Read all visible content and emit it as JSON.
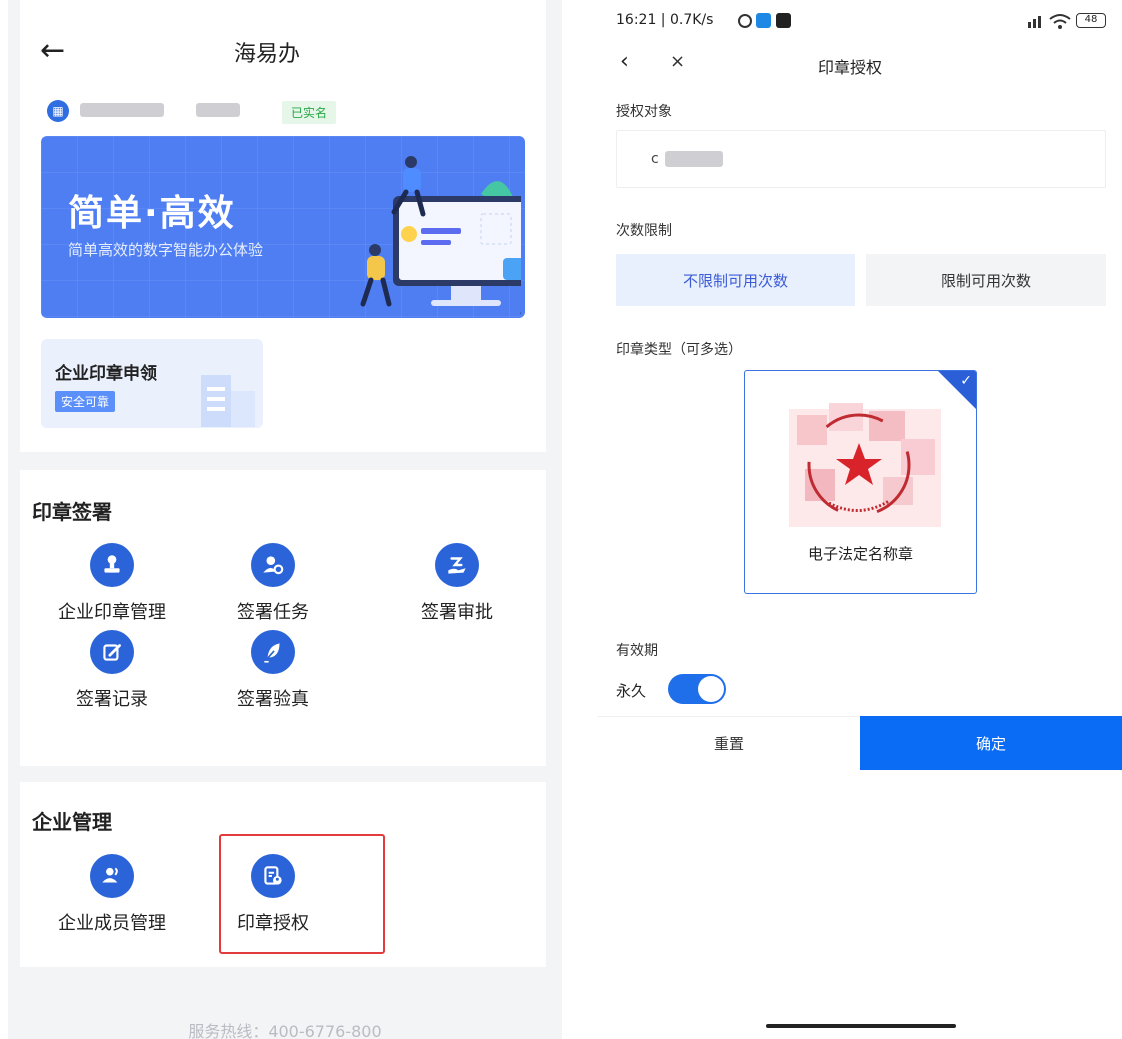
{
  "left": {
    "header": {
      "back_icon": "arrow-left-icon",
      "title": "海易办"
    },
    "company": {
      "verified_label": "已实名"
    },
    "banner": {
      "title": "简单·高效",
      "subtitle": "简单高效的数字智能办公体验"
    },
    "seal_apply_card": {
      "title": "企业印章申领",
      "tag": "安全可靠"
    },
    "seal_signing": {
      "title": "印章签署",
      "items": [
        {
          "label": "企业印章管理",
          "icon": "stamp-icon"
        },
        {
          "label": "签署任务",
          "icon": "user-gear-icon"
        },
        {
          "label": "签署审批",
          "icon": "hand-approve-icon"
        },
        {
          "label": "签署记录",
          "icon": "edit-record-icon"
        },
        {
          "label": "签署验真",
          "icon": "feather-verify-icon"
        }
      ]
    },
    "enterprise_mgmt": {
      "title": "企业管理",
      "items": [
        {
          "label": "企业成员管理",
          "icon": "members-icon"
        },
        {
          "label": "印章授权",
          "icon": "document-user-icon"
        }
      ]
    },
    "hotline": "服务热线：400-6776-800"
  },
  "right": {
    "status_bar": {
      "text": "16:21 | 0.7K/s",
      "battery": "48"
    },
    "nav": {
      "back_icon": "chevron-left-icon",
      "close_icon": "close-icon",
      "title": "印章授权"
    },
    "auth_target": {
      "label": "授权对象",
      "value": "c"
    },
    "count_limit": {
      "label": "次数限制",
      "options": [
        "不限制可用次数",
        "限制可用次数"
      ],
      "selected": "不限制可用次数"
    },
    "seal_type": {
      "label": "印章类型（可多选）",
      "option": {
        "name": "电子法定名称章",
        "checked": true
      }
    },
    "validity": {
      "label": "有效期",
      "value": "永久",
      "toggle_on": true
    },
    "buttons": {
      "reset": "重置",
      "confirm": "确定"
    },
    "colors": {
      "primary": "#0a6cf5",
      "seg_selected_bg": "#e8f0fe",
      "seg_selected_text": "#3b5bd6"
    }
  }
}
